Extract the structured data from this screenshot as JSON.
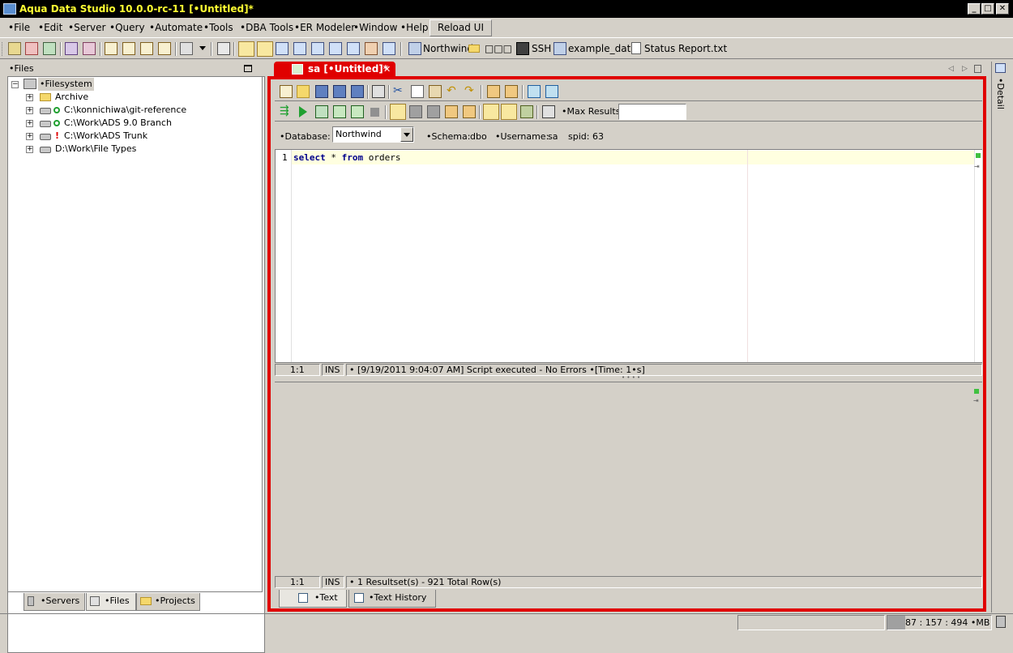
{
  "window": {
    "title": "Aqua Data Studio 10.0.0-rc-11 [•Untitled]*",
    "minimize": "_",
    "maximize": "□",
    "close": "✕"
  },
  "menu": {
    "items": [
      "•File",
      "•Edit",
      "•Server",
      "•Query",
      "•Automate",
      "•Tools",
      "•DBA Tools",
      "•ER Modeler",
      "•Window",
      "•Help"
    ],
    "reload": "Reload UI"
  },
  "toolbar": {
    "links": [
      "Northwind",
      "□□□",
      "SSH",
      "example_data",
      "Status Report.txt"
    ]
  },
  "left": {
    "header": "•Files",
    "tree": {
      "root": "•Filesystem",
      "nodes": [
        "Archive",
        "C:\\konnichiwa\\git-reference",
        "C:\\Work\\ADS 9.0 Branch",
        "C:\\Work\\ADS Trunk",
        "D:\\Work\\File Types"
      ]
    },
    "tabs": [
      "•Servers",
      "•Files",
      "•Projects"
    ]
  },
  "editor": {
    "tab_label": "sa [•Untitled]*",
    "max_results_label": "•Max Results:",
    "max_results_value": "",
    "database_label": "•Database:",
    "database_value": "Northwind",
    "schema_label": "•Schema:",
    "schema_value": "dbo",
    "username_label": "•Username:",
    "username_value": "sa",
    "spid_label": "spid:",
    "spid_value": "63",
    "line_number": "1",
    "code": {
      "kw1": "select",
      "mid": " * ",
      "kw2": "from",
      "rest": " orders"
    },
    "status": {
      "pos": "1:1",
      "mode": "INS",
      "message": "• [9/19/2011 9:04:07 AM] Script executed - No Errors •[Time: 1•s]"
    },
    "results_status": {
      "pos": "1:1",
      "mode": "INS",
      "message": "• 1 Resultset(s) - 921 Total Row(s)"
    },
    "results_tabs": [
      "•Text",
      "•Text History"
    ]
  },
  "detail": {
    "label": "•Detail"
  },
  "memory": "87 : 157 : 494 •MB"
}
